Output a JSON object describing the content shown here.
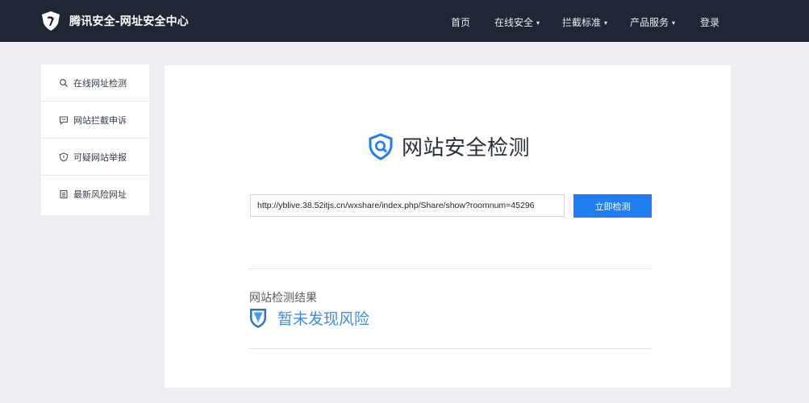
{
  "brand": {
    "title": "腾讯安全-网址安全中心"
  },
  "nav": {
    "items": [
      {
        "label": "首页",
        "has_dropdown": false
      },
      {
        "label": "在线安全",
        "has_dropdown": true
      },
      {
        "label": "拦截标准",
        "has_dropdown": true
      },
      {
        "label": "产品服务",
        "has_dropdown": true
      },
      {
        "label": "登录",
        "has_dropdown": false
      }
    ],
    "caret": "▾"
  },
  "sidebar": {
    "items": [
      {
        "label": "在线网址检测",
        "icon": "search-icon"
      },
      {
        "label": "网站拦截申诉",
        "icon": "message-icon"
      },
      {
        "label": "可疑网站举报",
        "icon": "shield-icon"
      },
      {
        "label": "最新风险网址",
        "icon": "list-icon"
      }
    ]
  },
  "main": {
    "title": "网站安全检测",
    "url_value": "http://yblive.38.52itjs.cn/wxshare/index.php/Share/show?roomnum=45296",
    "check_button": "立即检测",
    "result_label": "网站检测结果",
    "result_text": "暂未发现风险"
  },
  "colors": {
    "topbar": "#202634",
    "accent": "#1f7ef4",
    "result_text": "#3b8de6",
    "background": "#eeeef2"
  }
}
